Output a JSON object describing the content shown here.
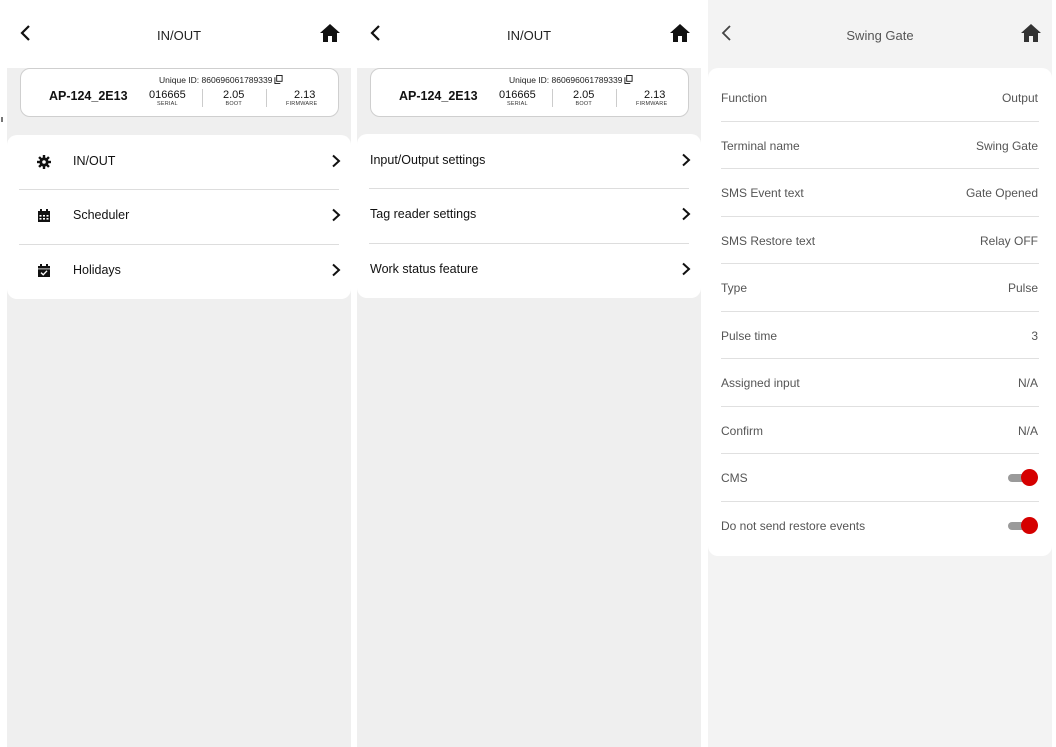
{
  "colors": {
    "accent": "#d50000",
    "panel_bg": "#efefef",
    "card_bg": "#ffffff"
  },
  "device": {
    "unique_id_label": "Unique ID: 860696061789339",
    "name": "AP-124_2E13",
    "serial_value": "016665",
    "serial_label": "SERIAL",
    "boot_value": "2.05",
    "boot_label": "BOOT",
    "firmware_value": "2.13",
    "firmware_label": "FIRMWARE"
  },
  "screen1": {
    "title": "IN/OUT",
    "menu": [
      {
        "label": "IN/OUT",
        "icon": "gear-icon"
      },
      {
        "label": "Scheduler",
        "icon": "calendar-icon"
      },
      {
        "label": "Holidays",
        "icon": "calendar-check-icon"
      }
    ]
  },
  "screen2": {
    "title": "IN/OUT",
    "menu": [
      {
        "label": "Input/Output settings"
      },
      {
        "label": "Tag reader settings"
      },
      {
        "label": "Work status feature"
      }
    ]
  },
  "screen3": {
    "title": "Swing Gate",
    "rows": [
      {
        "key": "Function",
        "value": "Output"
      },
      {
        "key": "Terminal name",
        "value": "Swing Gate"
      },
      {
        "key": "SMS Event text",
        "value": "Gate Opened"
      },
      {
        "key": "SMS Restore text",
        "value": "Relay OFF"
      },
      {
        "key": "Type",
        "value": "Pulse"
      },
      {
        "key": "Pulse time",
        "value": "3"
      },
      {
        "key": "Assigned input",
        "value": "N/A"
      },
      {
        "key": "Confirm",
        "value": "N/A"
      }
    ],
    "toggles": [
      {
        "key": "CMS",
        "on": true
      },
      {
        "key": "Do not send restore events",
        "on": true
      }
    ]
  }
}
